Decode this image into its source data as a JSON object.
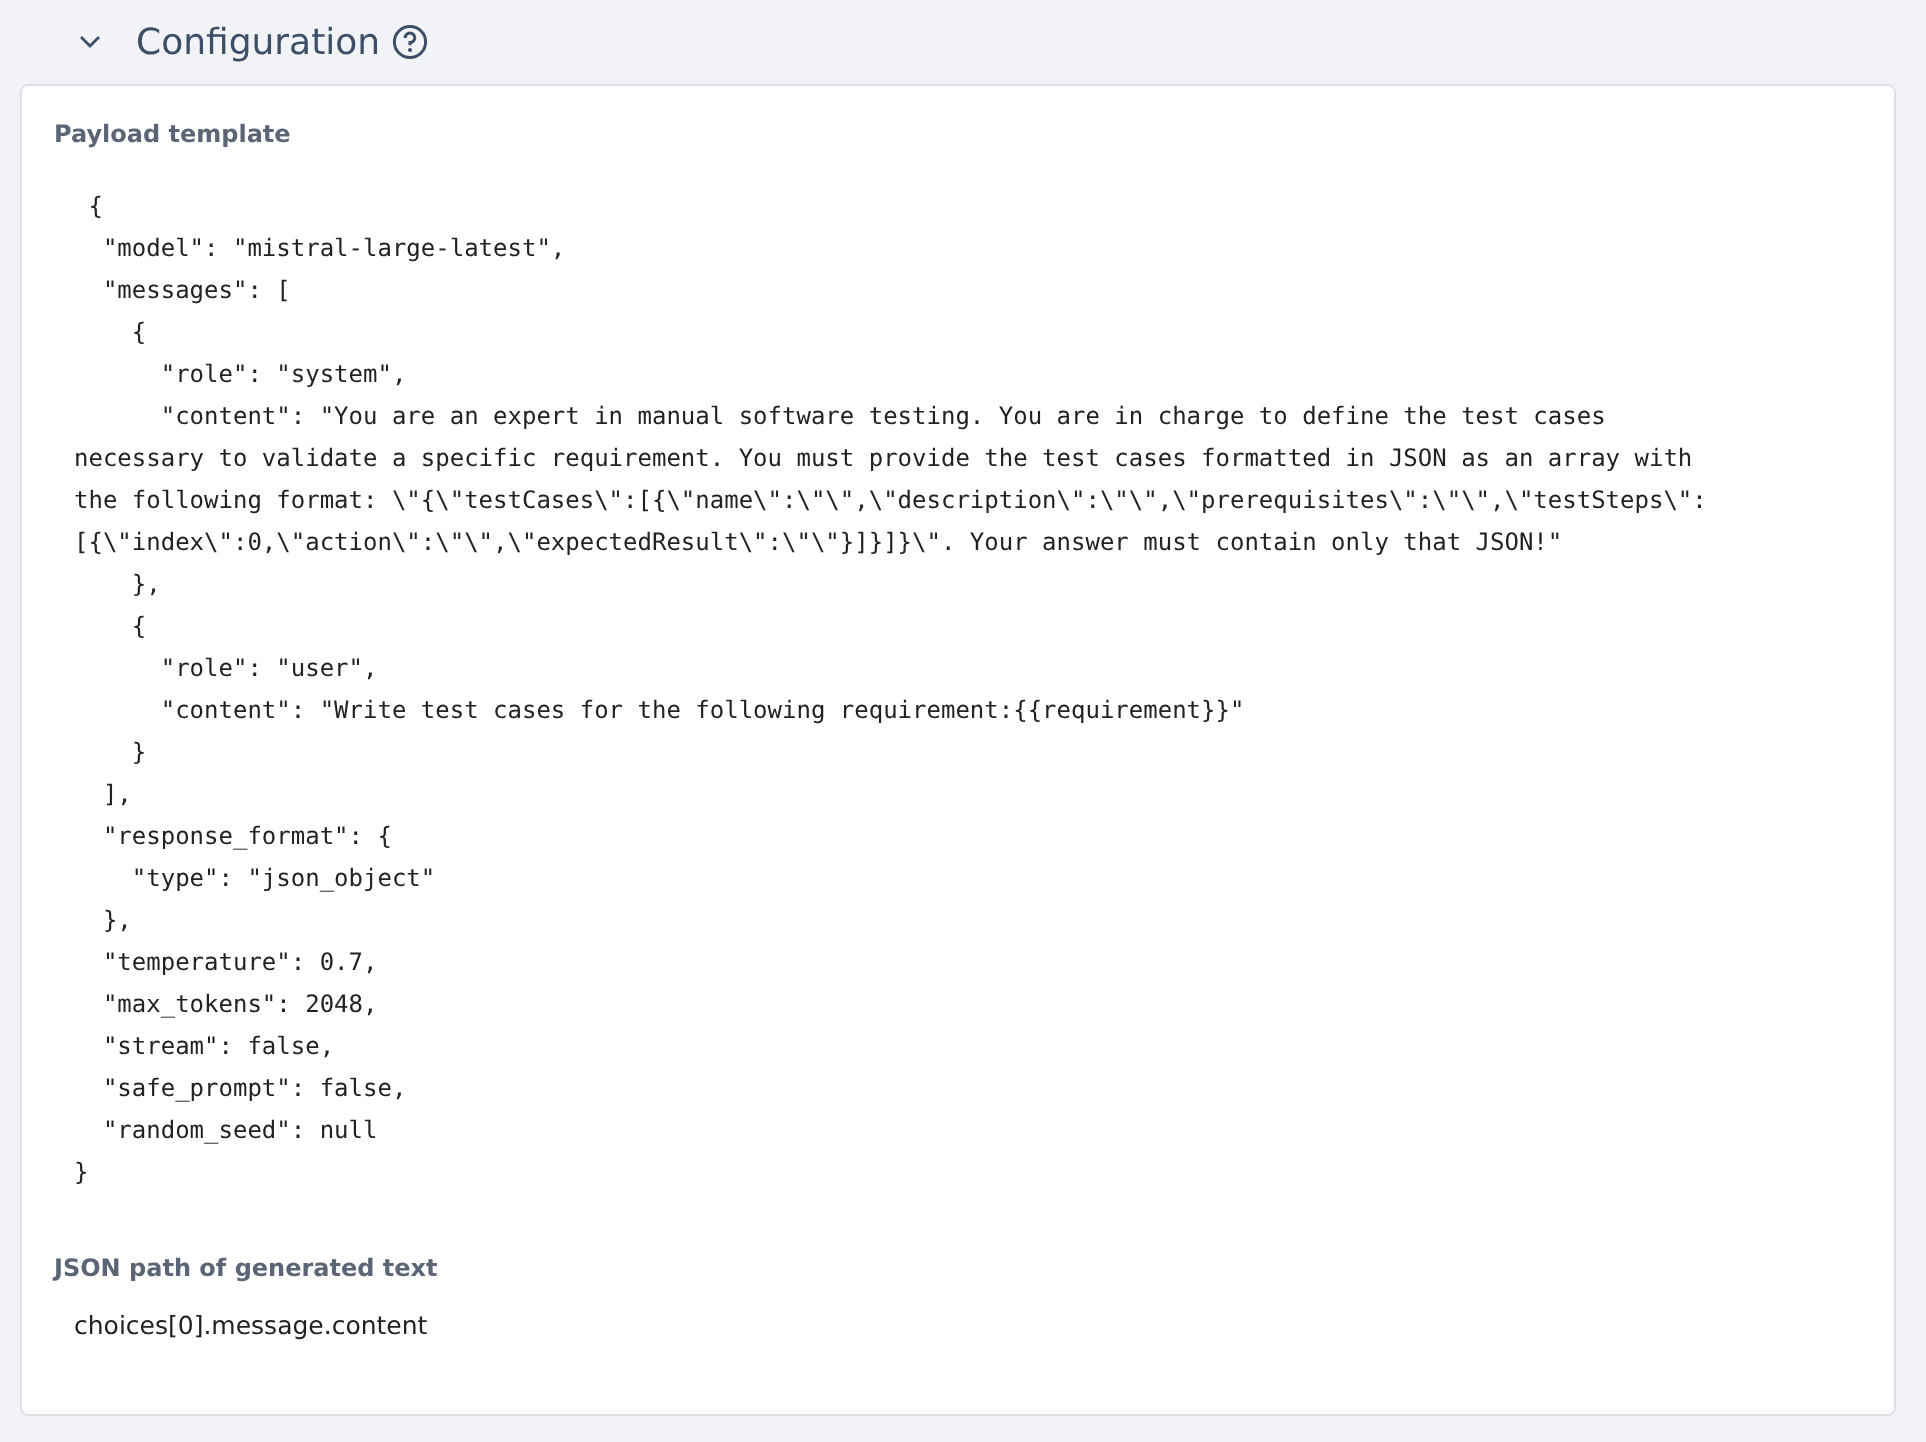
{
  "section": {
    "title": "Configuration",
    "expanded": true
  },
  "payload_template": {
    "label": "Payload template",
    "lines": [
      " {",
      "  \"model\": \"mistral-large-latest\",",
      "  \"messages\": [",
      "    {",
      "      \"role\": \"system\",",
      "      \"content\": \"You are an expert in manual software testing. You are in charge to define the test cases",
      "necessary to validate a specific requirement. You must provide the test cases formatted in JSON as an array with",
      "the following format: \\\"{\\\"testCases\\\":[{\\\"name\\\":\\\"\\\",\\\"description\\\":\\\"\\\",\\\"prerequisites\\\":\\\"\\\",\\\"testSteps\\\":",
      "[{\\\"index\\\":0,\\\"action\\\":\\\"\\\",\\\"expectedResult\\\":\\\"\\\"}]}]}\\\". Your answer must contain only that JSON!\"",
      "    },",
      "    {",
      "      \"role\": \"user\",",
      "      \"content\": \"Write test cases for the following requirement:{{requirement}}\"",
      "    }",
      "  ],",
      "  \"response_format\": {",
      "    \"type\": \"json_object\"",
      "  },",
      "  \"temperature\": 0.7,",
      "  \"max_tokens\": 2048,",
      "  \"stream\": false,",
      "  \"safe_prompt\": false,",
      "  \"random_seed\": null",
      "}"
    ]
  },
  "json_path": {
    "label": "JSON path of generated text",
    "value": "choices[0].message.content"
  }
}
